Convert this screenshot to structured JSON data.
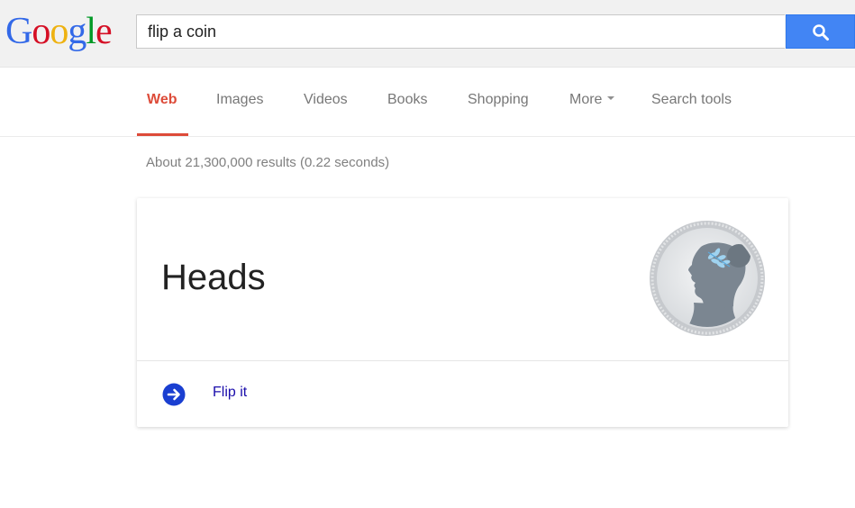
{
  "logo": {
    "letters": [
      "G",
      "o",
      "o",
      "g",
      "l",
      "e"
    ]
  },
  "search": {
    "query": "flip a coin",
    "button_icon": "search-icon"
  },
  "tabs": [
    {
      "label": "Web",
      "active": true
    },
    {
      "label": "Images",
      "active": false
    },
    {
      "label": "Videos",
      "active": false
    },
    {
      "label": "Books",
      "active": false
    },
    {
      "label": "Shopping",
      "active": false
    },
    {
      "label": "More",
      "active": false
    },
    {
      "label": "Search tools",
      "active": false
    }
  ],
  "result_stats": "About 21,300,000 results (0.22 seconds)",
  "coin_card": {
    "result": "Heads",
    "coin_icon": "coin-heads-icon",
    "action_label": "Flip it",
    "action_icon": "arrow-right-circle-icon"
  },
  "colors": {
    "header_bg": "#f1f1f1",
    "search_button": "#4285f4",
    "active_tab": "#dd4b39",
    "link": "#1a0dab",
    "flip_icon": "#1a3fd1"
  }
}
